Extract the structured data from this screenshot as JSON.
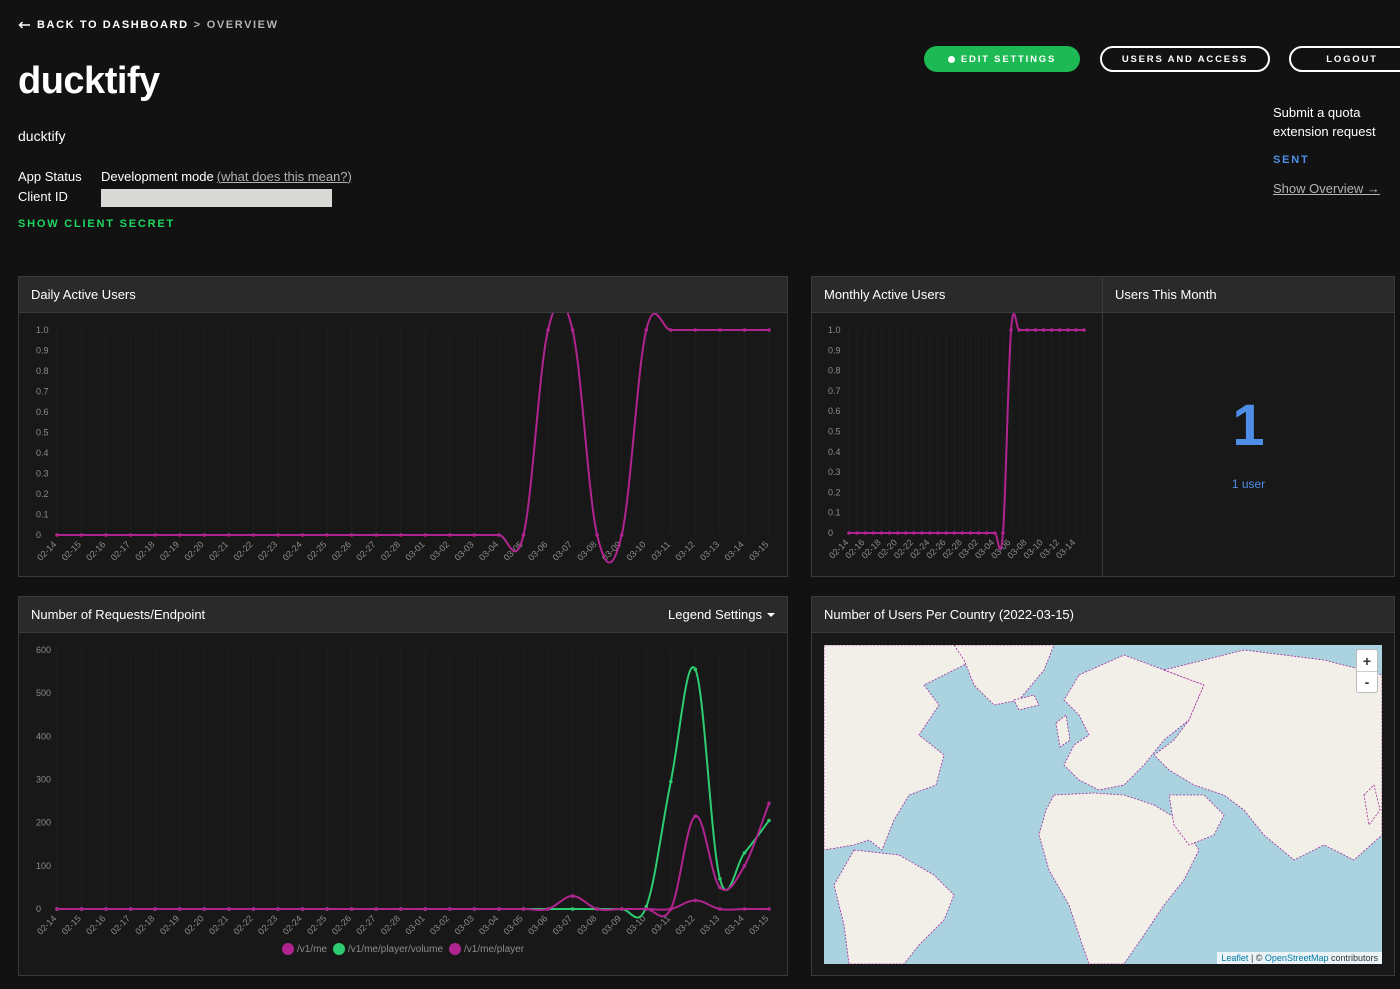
{
  "breadcrumb": {
    "back": "BACK TO DASHBOARD",
    "sep": ">",
    "current": "OVERVIEW"
  },
  "app": {
    "title": "ducktify",
    "description": "ducktify",
    "status_label": "App Status",
    "status_value": "Development mode",
    "status_link": "(what does this mean?)",
    "client_id_label": "Client ID",
    "show_secret": "SHOW CLIENT SECRET"
  },
  "actions": {
    "edit_settings": "EDIT SETTINGS",
    "users_access": "USERS AND ACCESS",
    "logout": "LOGOUT"
  },
  "quota": {
    "text": "Submit a quota extension request",
    "status": "SENT",
    "overview_link": "Show Overview →"
  },
  "colors": {
    "accent_green": "#1db954",
    "accent_blue": "#4e8ee6",
    "series_magenta": "#b0248f",
    "series_green": "#2ecc71"
  },
  "panels": {
    "dau": "Daily Active Users",
    "mau": "Monthly Active Users",
    "users_month": "Users This Month",
    "requests": "Number of Requests/Endpoint",
    "legend_settings": "Legend Settings",
    "country": "Number of Users Per Country (2022-03-15)"
  },
  "users_month": {
    "count": "1",
    "label": "1 user"
  },
  "map": {
    "zoom_in": "+",
    "zoom_out": "-",
    "attr_leaflet": "Leaflet",
    "attr_sep": " | © ",
    "attr_osm": "OpenStreetMap",
    "attr_tail": " contributors"
  },
  "chart_data": [
    {
      "id": "dau",
      "type": "line",
      "title": "Daily Active Users",
      "ylim": [
        0,
        1.0
      ],
      "yticks": [
        "0",
        "0.1",
        "0.2",
        "0.3",
        "0.4",
        "0.5",
        "0.6",
        "0.7",
        "0.8",
        "0.9",
        "1.0"
      ],
      "categories": [
        "02-14",
        "02-15",
        "02-16",
        "02-17",
        "02-18",
        "02-19",
        "02-20",
        "02-21",
        "02-22",
        "02-23",
        "02-24",
        "02-25",
        "02-26",
        "02-27",
        "02-28",
        "03-01",
        "03-02",
        "03-03",
        "03-04",
        "03-05",
        "03-06",
        "03-07",
        "03-08",
        "03-09",
        "03-10",
        "03-11",
        "03-12",
        "03-13",
        "03-14",
        "03-15"
      ],
      "series": [
        {
          "color": "#b0248f",
          "values": [
            0,
            0,
            0,
            0,
            0,
            0,
            0,
            0,
            0,
            0,
            0,
            0,
            0,
            0,
            0,
            0,
            0,
            0,
            0,
            0,
            1,
            1,
            0,
            0,
            1,
            1,
            1,
            1,
            1,
            1
          ]
        }
      ]
    },
    {
      "id": "mau",
      "type": "line",
      "title": "Monthly Active Users",
      "ylim": [
        0,
        1.0
      ],
      "yticks": [
        "0",
        "0.1",
        "0.2",
        "0.3",
        "0.4",
        "0.5",
        "0.6",
        "0.7",
        "0.8",
        "0.9",
        "1.0"
      ],
      "categories": [
        "02-14",
        "02-15",
        "02-16",
        "02-17",
        "02-18",
        "02-19",
        "02-20",
        "02-21",
        "02-22",
        "02-23",
        "02-24",
        "02-25",
        "02-26",
        "02-27",
        "02-28",
        "03-01",
        "03-02",
        "03-03",
        "03-04",
        "03-05",
        "03-06",
        "03-07",
        "03-08",
        "03-09",
        "03-10",
        "03-11",
        "03-12",
        "03-13",
        "03-14",
        "03-15"
      ],
      "tick_labels": [
        "02-14",
        "02-16",
        "02-18",
        "02-20",
        "02-22",
        "02-24",
        "02-26",
        "02-28",
        "03-02",
        "03-04",
        "03-06",
        "03-08",
        "03-10",
        "03-12",
        "03-14"
      ],
      "series": [
        {
          "color": "#b0248f",
          "values": [
            0,
            0,
            0,
            0,
            0,
            0,
            0,
            0,
            0,
            0,
            0,
            0,
            0,
            0,
            0,
            0,
            0,
            0,
            0,
            0,
            1,
            1,
            1,
            1,
            1,
            1,
            1,
            1,
            1,
            1
          ]
        }
      ]
    },
    {
      "id": "requests",
      "type": "line",
      "title": "Number of Requests/Endpoint",
      "ylim": [
        0,
        600
      ],
      "yticks": [
        "0",
        "100",
        "200",
        "300",
        "400",
        "500",
        "600"
      ],
      "categories": [
        "02-14",
        "02-15",
        "02-16",
        "02-17",
        "02-18",
        "02-19",
        "02-20",
        "02-21",
        "02-22",
        "02-23",
        "02-24",
        "02-25",
        "02-26",
        "02-27",
        "02-28",
        "03-01",
        "03-02",
        "03-03",
        "03-04",
        "03-05",
        "03-06",
        "03-07",
        "03-08",
        "03-09",
        "03-10",
        "03-11",
        "03-12",
        "03-13",
        "03-14",
        "03-15"
      ],
      "series": [
        {
          "name": "/v1/me",
          "color": "#b0248f",
          "values": [
            0,
            0,
            0,
            0,
            0,
            0,
            0,
            0,
            0,
            0,
            0,
            0,
            0,
            0,
            0,
            0,
            0,
            0,
            0,
            0,
            0,
            0,
            0,
            0,
            0,
            0,
            20,
            0,
            0,
            0
          ]
        },
        {
          "name": "/v1/me/player/volume",
          "color": "#2ecc71",
          "values": [
            0,
            0,
            0,
            0,
            0,
            0,
            0,
            0,
            0,
            0,
            0,
            0,
            0,
            0,
            0,
            0,
            0,
            0,
            0,
            0,
            0,
            0,
            0,
            0,
            5,
            295,
            555,
            70,
            130,
            205
          ]
        },
        {
          "name": "/v1/me/player",
          "color": "#b0248f",
          "values": [
            0,
            0,
            0,
            0,
            0,
            0,
            0,
            0,
            0,
            0,
            0,
            0,
            0,
            0,
            0,
            0,
            0,
            0,
            0,
            0,
            0,
            30,
            0,
            0,
            0,
            0,
            215,
            50,
            100,
            245
          ]
        }
      ]
    }
  ]
}
